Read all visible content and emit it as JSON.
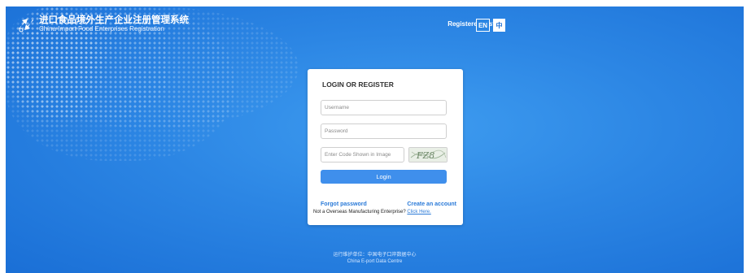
{
  "header": {
    "title": "进口食品境外生产企业注册管理系统",
    "subtitle": "China Import Food Enterprises Registration",
    "logo_icon": "arrows-logo-icon",
    "nav_registered_list": "Registered List",
    "lang_en": "EN",
    "lang_zh": "中"
  },
  "login": {
    "title": "LOGIN OR REGISTER",
    "username_placeholder": "Username",
    "password_placeholder": "Password",
    "code_placeholder": "Enter Code Shown in Image",
    "captcha_text": "FZ8",
    "login_label": "Login",
    "forgot_label": "Forgot password",
    "create_label": "Create an account",
    "note_text": "Not a Overseas Manufacturing Enterprise?",
    "note_link": "Click Here."
  },
  "footer": {
    "line1": "运行维护单位：中国电子口岸数据中心",
    "line2": "China E-port Data Centre"
  },
  "colors": {
    "background": "#2c86e4",
    "primary_button": "#3f8fec",
    "link": "#2a7ad8"
  }
}
